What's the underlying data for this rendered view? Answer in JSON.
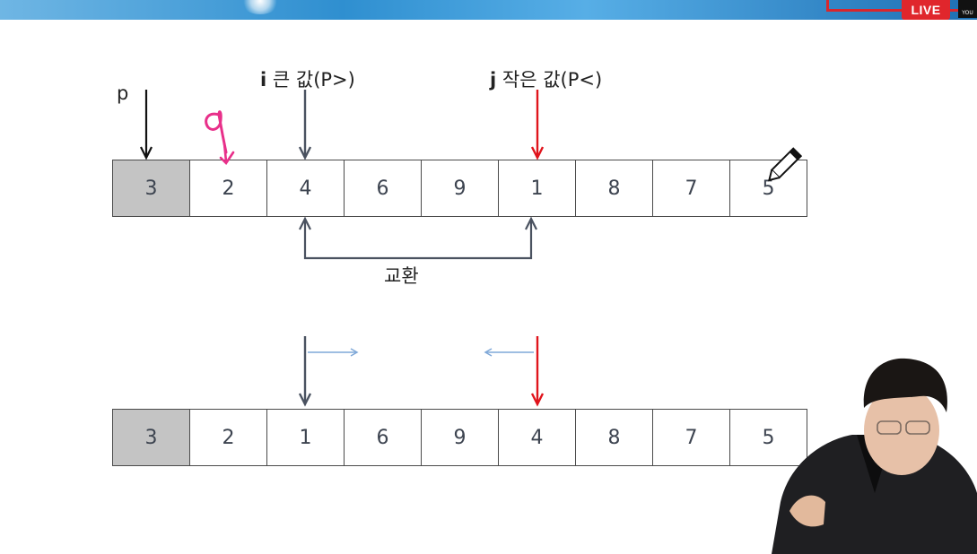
{
  "banner": {
    "live_label": "LIVE",
    "corner_label": "YOU"
  },
  "labels": {
    "p": "p",
    "i_letter": "i",
    "i_text": " 큰 값(P>)",
    "j_letter": "j",
    "j_text": " 작은 값(P<)",
    "swap": "교환",
    "annotation": "9"
  },
  "array_before": [
    "3",
    "2",
    "4",
    "6",
    "9",
    "1",
    "8",
    "7",
    "5"
  ],
  "array_after": [
    "3",
    "2",
    "1",
    "6",
    "9",
    "4",
    "8",
    "7",
    "5"
  ],
  "colors": {
    "pivot_fill": "#c4c4c4",
    "i_arrow": "#4a5260",
    "j_arrow": "#e0141c",
    "annotation": "#e8308a",
    "small_arrow": "#7fa8d8"
  },
  "icons": {
    "cursor": "pencil-cursor-icon"
  }
}
